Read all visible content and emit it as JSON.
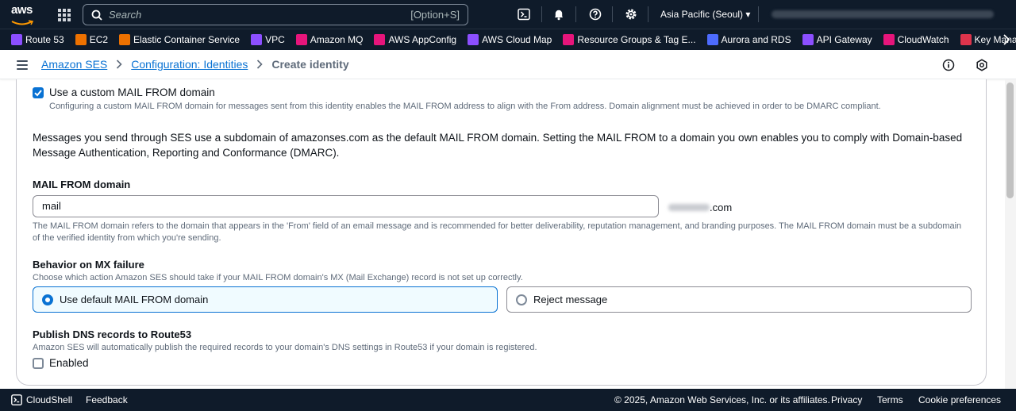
{
  "topnav": {
    "logo_text": "aws",
    "search_placeholder": "Search",
    "search_shortcut": "[Option+S]",
    "region": "Asia Pacific (Seoul) ▾",
    "icons": [
      "cloudshell-icon",
      "bell-icon",
      "help-icon",
      "gear-icon"
    ]
  },
  "favorites": [
    {
      "label": "Route 53",
      "color": "#8c4fff"
    },
    {
      "label": "EC2",
      "color": "#ed7100"
    },
    {
      "label": "Elastic Container Service",
      "color": "#ed7100"
    },
    {
      "label": "VPC",
      "color": "#8c4fff"
    },
    {
      "label": "Amazon MQ",
      "color": "#e7157b"
    },
    {
      "label": "AWS AppConfig",
      "color": "#e7157b"
    },
    {
      "label": "AWS Cloud Map",
      "color": "#8c4fff"
    },
    {
      "label": "Resource Groups & Tag E...",
      "color": "#e7157b"
    },
    {
      "label": "Aurora and RDS",
      "color": "#4d6bfe"
    },
    {
      "label": "API Gateway",
      "color": "#8c4fff"
    },
    {
      "label": "CloudWatch",
      "color": "#e7157b"
    },
    {
      "label": "Key Management Se",
      "color": "#dd344c"
    }
  ],
  "breadcrumb": {
    "item1": "Amazon SES",
    "item2": "Configuration: Identities",
    "current": "Create identity"
  },
  "mail_from": {
    "checkbox_label": "Use a custom MAIL FROM domain",
    "checkbox_checked": true,
    "checkbox_desc": "Configuring a custom MAIL FROM domain for messages sent from this identity enables the MAIL FROM address to align with the From address. Domain alignment must be achieved in order to be DMARC compliant.",
    "intro": "Messages you send through SES use a subdomain of amazonses.com as the default MAIL FROM domain. Setting the MAIL FROM to a domain you own enables you to comply with Domain-based Message Authentication, Reporting and Conformance (DMARC).",
    "field_label": "MAIL FROM domain",
    "field_value": "mail",
    "domain_suffix": ".com",
    "field_desc": "The MAIL FROM domain refers to the domain that appears in the 'From' field of an email message and is recommended for better deliverability, reputation management, and branding purposes. The MAIL FROM domain must be a subdomain of the verified identity from which you're sending."
  },
  "mx_failure": {
    "title": "Behavior on MX failure",
    "desc": "Choose which action Amazon SES should take if your MAIL FROM domain's MX (Mail Exchange) record is not set up correctly.",
    "option1": "Use default MAIL FROM domain",
    "option2": "Reject message",
    "selected": "Use default MAIL FROM domain"
  },
  "dns": {
    "title": "Publish DNS records to Route53",
    "desc": "Amazon SES will automatically publish the required records to your domain's DNS settings in Route53 if your domain is registered.",
    "checkbox_label": "Enabled",
    "checked": false
  },
  "footer": {
    "cloudshell": "CloudShell",
    "feedback": "Feedback",
    "copyright": "© 2025, Amazon Web Services, Inc. or its affiliates.",
    "privacy": "Privacy",
    "terms": "Terms",
    "cookies": "Cookie preferences"
  }
}
